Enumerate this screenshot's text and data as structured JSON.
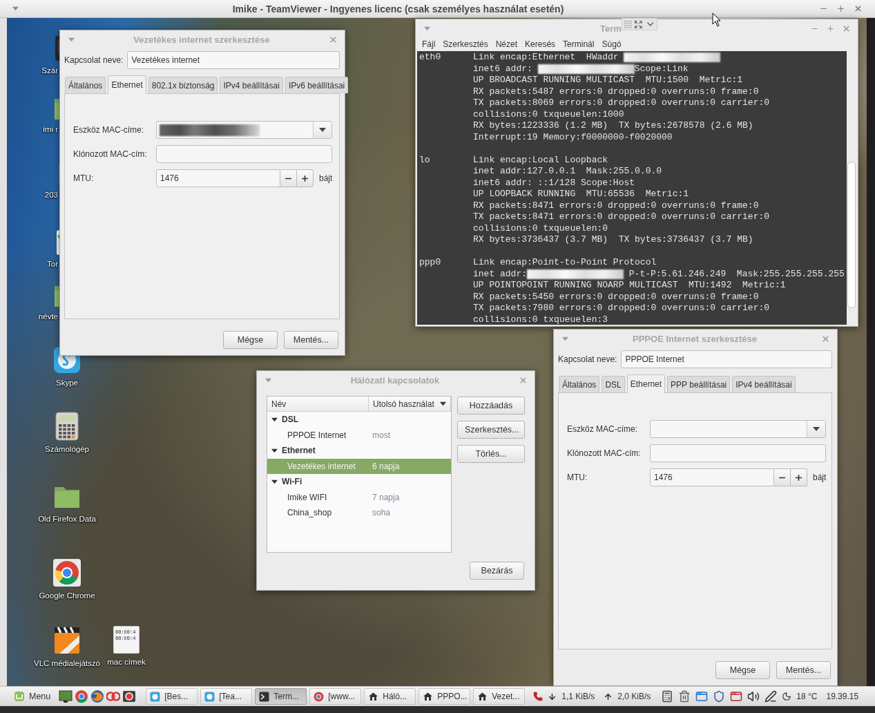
{
  "screen_title_bar": {
    "title": "Imike - TeamViewer - Ingyenes licenc (csak személyes használat esetén)"
  },
  "desktop_icons": [
    {
      "label": "Szár",
      "kind": "dark-app"
    },
    {
      "label": "imi r",
      "kind": "folder"
    },
    {
      "label": "203",
      "kind": "drive"
    },
    {
      "label": "Tor",
      "kind": "spreadsheet"
    },
    {
      "label": "névte",
      "kind": "folder"
    },
    {
      "label": "Skype",
      "kind": "chat"
    },
    {
      "label": "Számológép",
      "kind": "calculator"
    },
    {
      "label": "Old Firefox Data",
      "kind": "folder"
    },
    {
      "label": "Google Chrome",
      "kind": "browser"
    },
    {
      "label": "VLC médialejátszó",
      "kind": "media"
    },
    {
      "label": "mac címek",
      "kind": "text-file",
      "preview_lines": [
        "00:E0:4",
        "00:E0:4"
      ]
    }
  ],
  "terminal": {
    "title": "Term",
    "menu": [
      "Fájl",
      "Szerkesztés",
      "Nézet",
      "Keresés",
      "Terminál",
      "Súgó"
    ],
    "interfaces": [
      {
        "name": "eth0",
        "lines": [
          {
            "segments": [
              {
                "kind": "text",
                "text": "Link encap:Ethernet  HWaddr "
              },
              {
                "kind": "redacted"
              }
            ]
          },
          {
            "segments": [
              {
                "kind": "text",
                "text": "inet6 addr: "
              },
              {
                "kind": "redacted"
              },
              {
                "kind": "text",
                "text": "Scope:Link"
              }
            ]
          },
          {
            "segments": [
              {
                "kind": "text",
                "text": "UP BROADCAST RUNNING MULTICAST  MTU:1500  Metric:1"
              }
            ]
          },
          {
            "segments": [
              {
                "kind": "text",
                "text": "RX packets:5487 errors:0 dropped:0 overruns:0 frame:0"
              }
            ]
          },
          {
            "segments": [
              {
                "kind": "text",
                "text": "TX packets:8069 errors:0 dropped:0 overruns:0 carrier:0"
              }
            ]
          },
          {
            "segments": [
              {
                "kind": "text",
                "text": "collisions:0 txqueuelen:1000"
              }
            ]
          },
          {
            "segments": [
              {
                "kind": "text",
                "text": "RX bytes:1223336 (1.2 MB)  TX bytes:2678578 (2.6 MB)"
              }
            ]
          },
          {
            "segments": [
              {
                "kind": "text",
                "text": "Interrupt:19 Memory:f0000000-f0020000"
              }
            ]
          }
        ]
      },
      {
        "name": "lo",
        "lines": [
          {
            "segments": [
              {
                "kind": "text",
                "text": "Link encap:Local Loopback"
              }
            ]
          },
          {
            "segments": [
              {
                "kind": "text",
                "text": "inet addr:127.0.0.1  Mask:255.0.0.0"
              }
            ]
          },
          {
            "segments": [
              {
                "kind": "text",
                "text": "inet6 addr: ::1/128 Scope:Host"
              }
            ]
          },
          {
            "segments": [
              {
                "kind": "text",
                "text": "UP LOOPBACK RUNNING  MTU:65536  Metric:1"
              }
            ]
          },
          {
            "segments": [
              {
                "kind": "text",
                "text": "RX packets:8471 errors:0 dropped:0 overruns:0 frame:0"
              }
            ]
          },
          {
            "segments": [
              {
                "kind": "text",
                "text": "TX packets:8471 errors:0 dropped:0 overruns:0 carrier:0"
              }
            ]
          },
          {
            "segments": [
              {
                "kind": "text",
                "text": "collisions:0 txqueuelen:0"
              }
            ]
          },
          {
            "segments": [
              {
                "kind": "text",
                "text": "RX bytes:3736437 (3.7 MB)  TX bytes:3736437 (3.7 MB)"
              }
            ]
          }
        ]
      },
      {
        "name": "ppp0",
        "lines": [
          {
            "segments": [
              {
                "kind": "text",
                "text": "Link encap:Point-to-Point Protocol"
              }
            ]
          },
          {
            "segments": [
              {
                "kind": "text",
                "text": "inet addr:"
              },
              {
                "kind": "redacted"
              },
              {
                "kind": "text",
                "text": " P-t-P:5.61.246.249  Mask:255.255.255.255"
              }
            ]
          },
          {
            "segments": [
              {
                "kind": "text",
                "text": "UP POINTOPOINT RUNNING NOARP MULTICAST  MTU:1492  Metric:1"
              }
            ]
          },
          {
            "segments": [
              {
                "kind": "text",
                "text": "RX packets:5450 errors:0 dropped:0 overruns:0 frame:0"
              }
            ]
          },
          {
            "segments": [
              {
                "kind": "text",
                "text": "TX packets:7980 errors:0 dropped:0 overruns:0 carrier:0"
              }
            ]
          },
          {
            "segments": [
              {
                "kind": "text",
                "text": "collisions:0 txqueuelen:3"
              }
            ]
          }
        ]
      }
    ]
  },
  "wired_dialog": {
    "title": "Vezetékes internet szerkesztése",
    "name_label": "Kapcsolat neve:",
    "name_value": "Vezetékes internet",
    "tabs": [
      {
        "label": "Általános",
        "selected": false
      },
      {
        "label": "Ethernet",
        "selected": true
      },
      {
        "label": "802.1x biztonság",
        "selected": false
      },
      {
        "label": "IPv4 beállításai",
        "selected": false
      },
      {
        "label": "IPv6 beállításai",
        "selected": false
      }
    ],
    "fields": [
      {
        "kind": "combo",
        "label": "Eszköz MAC-címe:",
        "redacted": true
      },
      {
        "kind": "text",
        "label": "Klónozott MAC-cím:"
      },
      {
        "kind": "spin",
        "label": "MTU:",
        "value": "1476",
        "unit": "bájt"
      }
    ],
    "buttons": [
      "Mégse",
      "Mentés..."
    ]
  },
  "connections_dialog": {
    "title": "Hálózati kapcsolatok",
    "columns": [
      {
        "label": "Név",
        "sorted": false
      },
      {
        "label": "Utolsó használat",
        "sorted": true
      }
    ],
    "groups": [
      {
        "label": "DSL",
        "expanded": true,
        "children": [
          {
            "name": "PPPOE Internet",
            "last_used": "most",
            "selected": false
          }
        ]
      },
      {
        "label": "Ethernet",
        "expanded": true,
        "children": [
          {
            "name": "Vezetékes internet",
            "last_used": "6 napja",
            "selected": true
          }
        ]
      },
      {
        "label": "Wi-Fi",
        "expanded": true,
        "children": [
          {
            "name": "Imike WIFI",
            "last_used": "7 napja",
            "selected": false
          },
          {
            "name": "China_shop",
            "last_used": "soha",
            "selected": false
          }
        ]
      }
    ],
    "actions": [
      "Hozzáadás",
      "Szerkesztés...",
      "Törlés..."
    ],
    "close_button": "Bezárás"
  },
  "pppoe_dialog": {
    "title": "PPPOE Internet szerkesztése",
    "name_label": "Kapcsolat neve:",
    "name_value": "PPPOE Internet",
    "tabs": [
      {
        "label": "Általános",
        "selected": false
      },
      {
        "label": "DSL",
        "selected": false
      },
      {
        "label": "Ethernet",
        "selected": true
      },
      {
        "label": "PPP beállításai",
        "selected": false
      },
      {
        "label": "IPv4 beállításai",
        "selected": false
      }
    ],
    "fields": [
      {
        "kind": "combo",
        "label": "Eszköz MAC-címe:",
        "redacted": false
      },
      {
        "kind": "text",
        "label": "Klónozott MAC-cím:"
      },
      {
        "kind": "spin",
        "label": "MTU:",
        "value": "1476",
        "unit": "bájt"
      }
    ],
    "buttons": [
      "Mégse",
      "Mentés..."
    ]
  },
  "taskbar": {
    "menu_label": "Menu",
    "tasks": [
      {
        "label": "[Bes...",
        "kind": "chat",
        "selected": false
      },
      {
        "label": "[Tea...",
        "kind": "chat",
        "selected": false
      },
      {
        "label": "Term...",
        "kind": "terminal",
        "selected": true
      },
      {
        "label": "[www...",
        "kind": "browser",
        "selected": false
      },
      {
        "label": "Háló...",
        "kind": "network",
        "selected": false
      },
      {
        "label": "PPPO...",
        "kind": "network",
        "selected": false
      },
      {
        "label": "Vezet...",
        "kind": "network",
        "selected": false
      }
    ],
    "download_rate": "1,1 KiB/s",
    "upload_rate": "2,0 KiB/s",
    "temperature": "18 °C",
    "clock": "19.39.15"
  }
}
